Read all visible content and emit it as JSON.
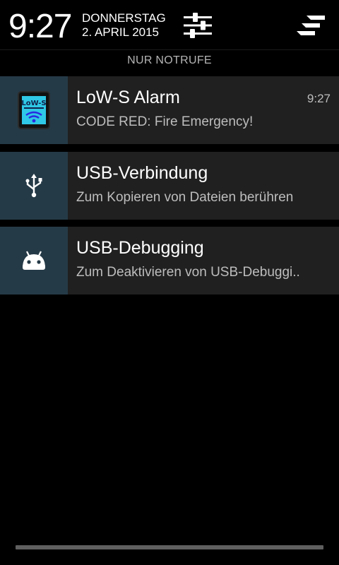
{
  "header": {
    "time": "9:27",
    "day": "DONNERSTAG",
    "date": "2. APRIL 2015"
  },
  "carrier": "NUR NOTRUFE",
  "notifications": [
    {
      "title": "LoW-S Alarm",
      "text": "CODE RED: Fire Emergency!",
      "time": "9:27",
      "icon": "lows-alarm-app-icon",
      "icon_label": "LoW-S"
    },
    {
      "title": "USB-Verbindung",
      "text": "Zum Kopieren von Dateien berühren",
      "icon": "usb-icon"
    },
    {
      "title": "USB-Debugging",
      "text": "Zum Deaktivieren von USB-Debuggi..",
      "icon": "android-icon"
    }
  ],
  "colors": {
    "background": "#000000",
    "notification_bg": "#202020",
    "icon_bg": "#253a47",
    "secondary_text": "#bdbdbd"
  }
}
